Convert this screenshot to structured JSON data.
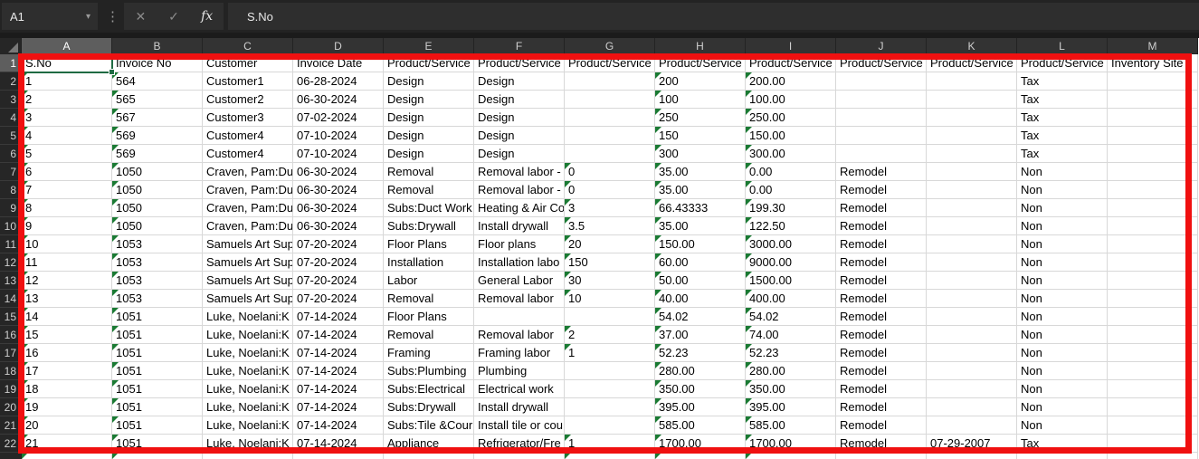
{
  "formula_bar": {
    "name_box_value": "A1",
    "formula_value": "S.No"
  },
  "icons": {
    "dropdown": "▾",
    "dots": "⋮",
    "close": "✕",
    "check": "✓",
    "fx": "fx"
  },
  "selection": {
    "cell": "A1",
    "column": "A",
    "row": 1
  },
  "colors": {
    "annotation_red_border": "#f01010",
    "selection_green": "#1f6b43",
    "error_triangle_green": "#1a7a33",
    "chrome_bg": "#232323",
    "chrome_panel": "#2e2e2e",
    "column_header_bg": "#333333",
    "selected_header_bg": "#5e5e5e",
    "gridline": "#d8d8d8"
  },
  "sheet": {
    "columns": [
      "A",
      "B",
      "C",
      "D",
      "E",
      "F",
      "G",
      "H",
      "I",
      "J",
      "K",
      "L",
      "M"
    ],
    "data_header": [
      "S.No",
      "Invoice No",
      "Customer",
      "Invoice Date",
      "Product/Service",
      "Product/Service",
      "Product/Service",
      "Product/Service",
      "Product/Service",
      "Product/Service",
      "Product/Service",
      "Product/Service",
      "Inventory Site"
    ],
    "rows": [
      [
        "1",
        "564",
        "Customer1",
        "06-28-2024",
        "Design",
        "Design",
        "",
        "200",
        "200.00",
        "",
        "",
        "Tax",
        ""
      ],
      [
        "2",
        "565",
        "Customer2",
        "06-30-2024",
        "Design",
        "Design",
        "",
        "100",
        "100.00",
        "",
        "",
        "Tax",
        ""
      ],
      [
        "3",
        "567",
        "Customer3",
        "07-02-2024",
        "Design",
        "Design",
        "",
        "250",
        "250.00",
        "",
        "",
        "Tax",
        ""
      ],
      [
        "4",
        "569",
        "Customer4",
        "07-10-2024",
        "Design",
        "Design",
        "",
        "150",
        "150.00",
        "",
        "",
        "Tax",
        ""
      ],
      [
        "5",
        "569",
        "Customer4",
        "07-10-2024",
        "Design",
        "Design",
        "",
        "300",
        "300.00",
        "",
        "",
        "Tax",
        ""
      ],
      [
        "6",
        "1050",
        "Craven, Pam:Du",
        "06-30-2024",
        "Removal",
        "Removal labor -",
        "0",
        "35.00",
        "0.00",
        "Remodel",
        "",
        "Non",
        ""
      ],
      [
        "7",
        "1050",
        "Craven, Pam:Du",
        "06-30-2024",
        "Removal",
        "Removal labor -",
        "0",
        "35.00",
        "0.00",
        "Remodel",
        "",
        "Non",
        ""
      ],
      [
        "8",
        "1050",
        "Craven, Pam:Du",
        "06-30-2024",
        "Subs:Duct Work",
        "Heating & Air Co",
        "3",
        "66.43333",
        "199.30",
        "Remodel",
        "",
        "Non",
        ""
      ],
      [
        "9",
        "1050",
        "Craven, Pam:Du",
        "06-30-2024",
        "Subs:Drywall",
        "Install drywall",
        "3.5",
        "35.00",
        "122.50",
        "Remodel",
        "",
        "Non",
        ""
      ],
      [
        "10",
        "1053",
        "Samuels Art Sup",
        "07-20-2024",
        "Floor Plans",
        "Floor plans",
        "20",
        "150.00",
        "3000.00",
        "Remodel",
        "",
        "Non",
        ""
      ],
      [
        "11",
        "1053",
        "Samuels Art Sup",
        "07-20-2024",
        "Installation",
        "Installation labo",
        "150",
        "60.00",
        "9000.00",
        "Remodel",
        "",
        "Non",
        ""
      ],
      [
        "12",
        "1053",
        "Samuels Art Sup",
        "07-20-2024",
        "Labor",
        "General Labor",
        "30",
        "50.00",
        "1500.00",
        "Remodel",
        "",
        "Non",
        ""
      ],
      [
        "13",
        "1053",
        "Samuels Art Sup",
        "07-20-2024",
        "Removal",
        "Removal labor",
        "10",
        "40.00",
        "400.00",
        "Remodel",
        "",
        "Non",
        ""
      ],
      [
        "14",
        "1051",
        "Luke, Noelani:K",
        "07-14-2024",
        "Floor Plans",
        "",
        "",
        "54.02",
        "54.02",
        "Remodel",
        "",
        "Non",
        ""
      ],
      [
        "15",
        "1051",
        "Luke, Noelani:K",
        "07-14-2024",
        "Removal",
        "Removal labor",
        "2",
        "37.00",
        "74.00",
        "Remodel",
        "",
        "Non",
        ""
      ],
      [
        "16",
        "1051",
        "Luke, Noelani:K",
        "07-14-2024",
        "Framing",
        "Framing labor",
        "1",
        "52.23",
        "52.23",
        "Remodel",
        "",
        "Non",
        ""
      ],
      [
        "17",
        "1051",
        "Luke, Noelani:K",
        "07-14-2024",
        "Subs:Plumbing",
        "Plumbing",
        "",
        "280.00",
        "280.00",
        "Remodel",
        "",
        "Non",
        ""
      ],
      [
        "18",
        "1051",
        "Luke, Noelani:K",
        "07-14-2024",
        "Subs:Electrical",
        "Electrical work",
        "",
        "350.00",
        "350.00",
        "Remodel",
        "",
        "Non",
        ""
      ],
      [
        "19",
        "1051",
        "Luke, Noelani:K",
        "07-14-2024",
        "Subs:Drywall",
        "Install drywall",
        "",
        "395.00",
        "395.00",
        "Remodel",
        "",
        "Non",
        ""
      ],
      [
        "20",
        "1051",
        "Luke, Noelani:K",
        "07-14-2024",
        "Subs:Tile &Cour",
        "Install tile or cou",
        "",
        "585.00",
        "585.00",
        "Remodel",
        "",
        "Non",
        ""
      ],
      [
        "21",
        "1051",
        "Luke, Noelani:K",
        "07-14-2024",
        "Appliance",
        "Refrigerator/Fre",
        "1",
        "1700.00",
        "1700.00",
        "Remodel",
        "07-29-2007",
        "Tax",
        ""
      ]
    ],
    "error_indicator_columns": [
      0,
      1,
      6,
      7,
      8
    ]
  }
}
